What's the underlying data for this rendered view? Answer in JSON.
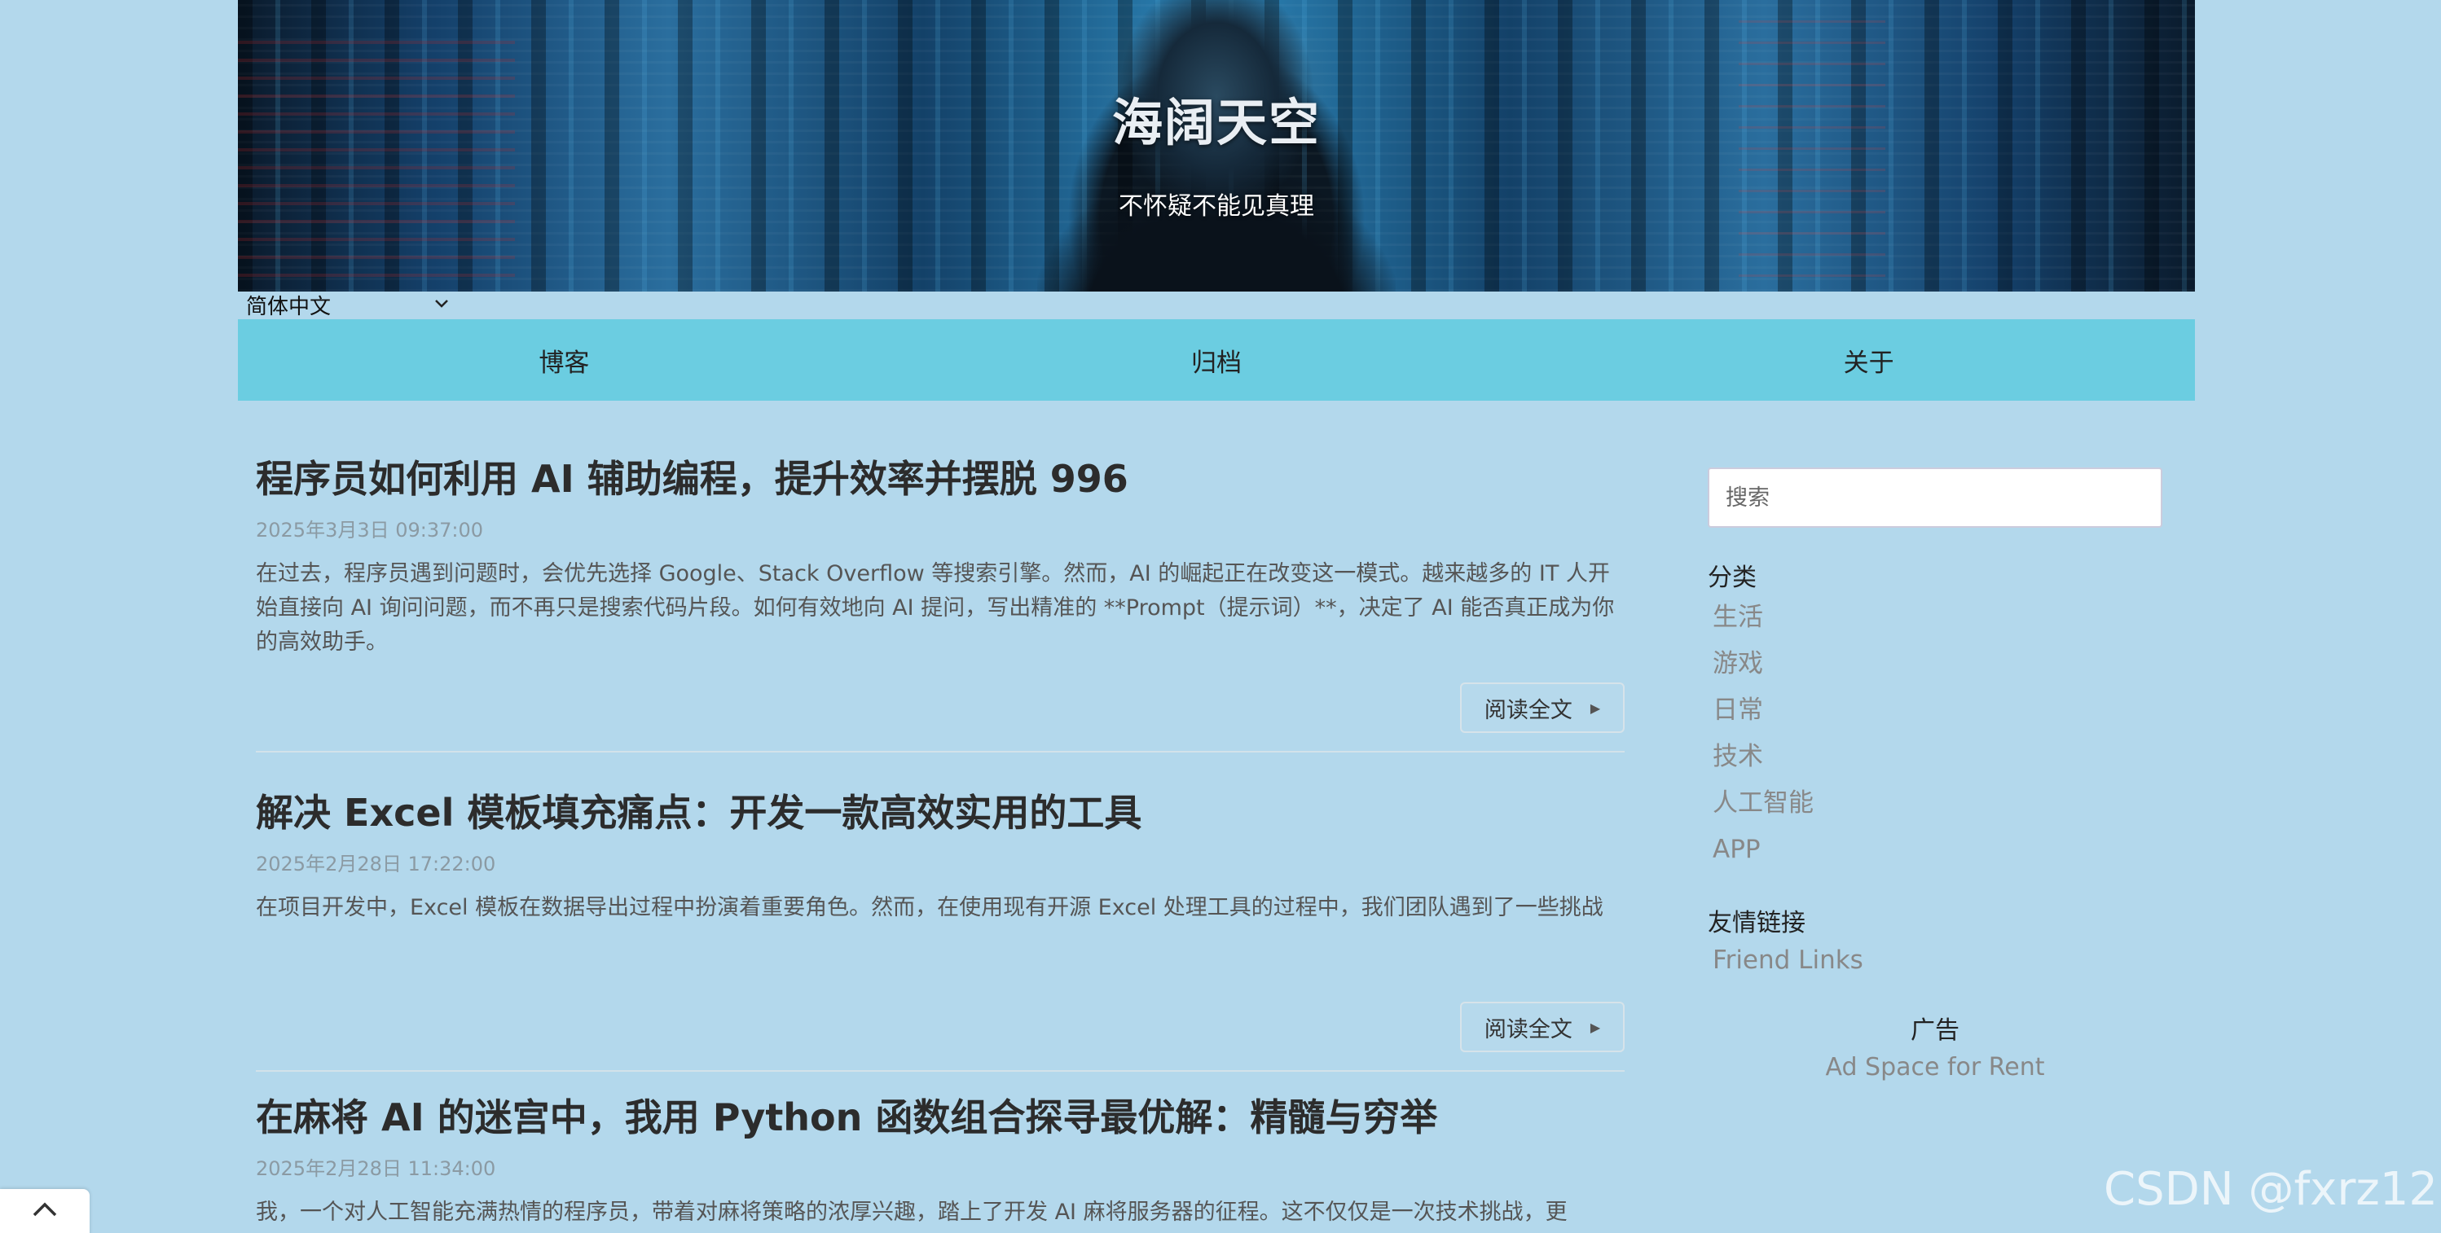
{
  "header": {
    "title": "海阔天空",
    "subtitle": "不怀疑不能见真理"
  },
  "language": {
    "selected": "简体中文"
  },
  "nav": {
    "items": [
      {
        "label": "博客"
      },
      {
        "label": "归档"
      },
      {
        "label": "关于"
      }
    ]
  },
  "posts": [
    {
      "title": "程序员如何利用 AI 辅助编程，提升效率并摆脱 996",
      "date": "2025年3月3日 09:37:00",
      "excerpt": "在过去，程序员遇到问题时，会优先选择 Google、Stack Overflow 等搜索引擎。然而，AI 的崛起正在改变这一模式。越来越多的 IT 人开始直接向 AI 询问问题，而不再只是搜索代码片段。如何有效地向 AI 提问，写出精准的 **Prompt（提示词）**，决定了 AI 能否真正成为你的高效助手。",
      "read_more": "阅读全文"
    },
    {
      "title": "解决 Excel 模板填充痛点：开发一款高效实用的工具",
      "date": "2025年2月28日 17:22:00",
      "excerpt": "在项目开发中，Excel 模板在数据导出过程中扮演着重要角色。然而，在使用现有开源 Excel 处理工具的过程中，我们团队遇到了一些挑战",
      "read_more": "阅读全文"
    },
    {
      "title": "在麻将 AI 的迷宫中，我用 Python 函数组合探寻最优解：精髓与穷举",
      "date": "2025年2月28日 11:34:00",
      "excerpt": "我，一个对人工智能充满热情的程序员，带着对麻将策略的浓厚兴趣，踏上了开发 AI 麻将服务器的征程。这不仅仅是一次技术挑战，更"
    }
  ],
  "sidebar": {
    "search_placeholder": "搜索",
    "categories_heading": "分类",
    "categories": [
      "生活",
      "游戏",
      "日常",
      "技术",
      "人工智能",
      "APP"
    ],
    "links_heading": "友情链接",
    "links": [
      "Friend Links"
    ],
    "ad_heading": "广告",
    "ad_text": "Ad Space for Rent"
  },
  "watermark": "CSDN @fxrz12",
  "icons": {
    "scroll_top": "chevron-up-icon",
    "read_more_arrow": "caret-right-icon",
    "language_dropdown": "chevron-down-icon"
  },
  "colors": {
    "page_background": "#b3d8ec",
    "nav_background": "#6bcde1"
  }
}
